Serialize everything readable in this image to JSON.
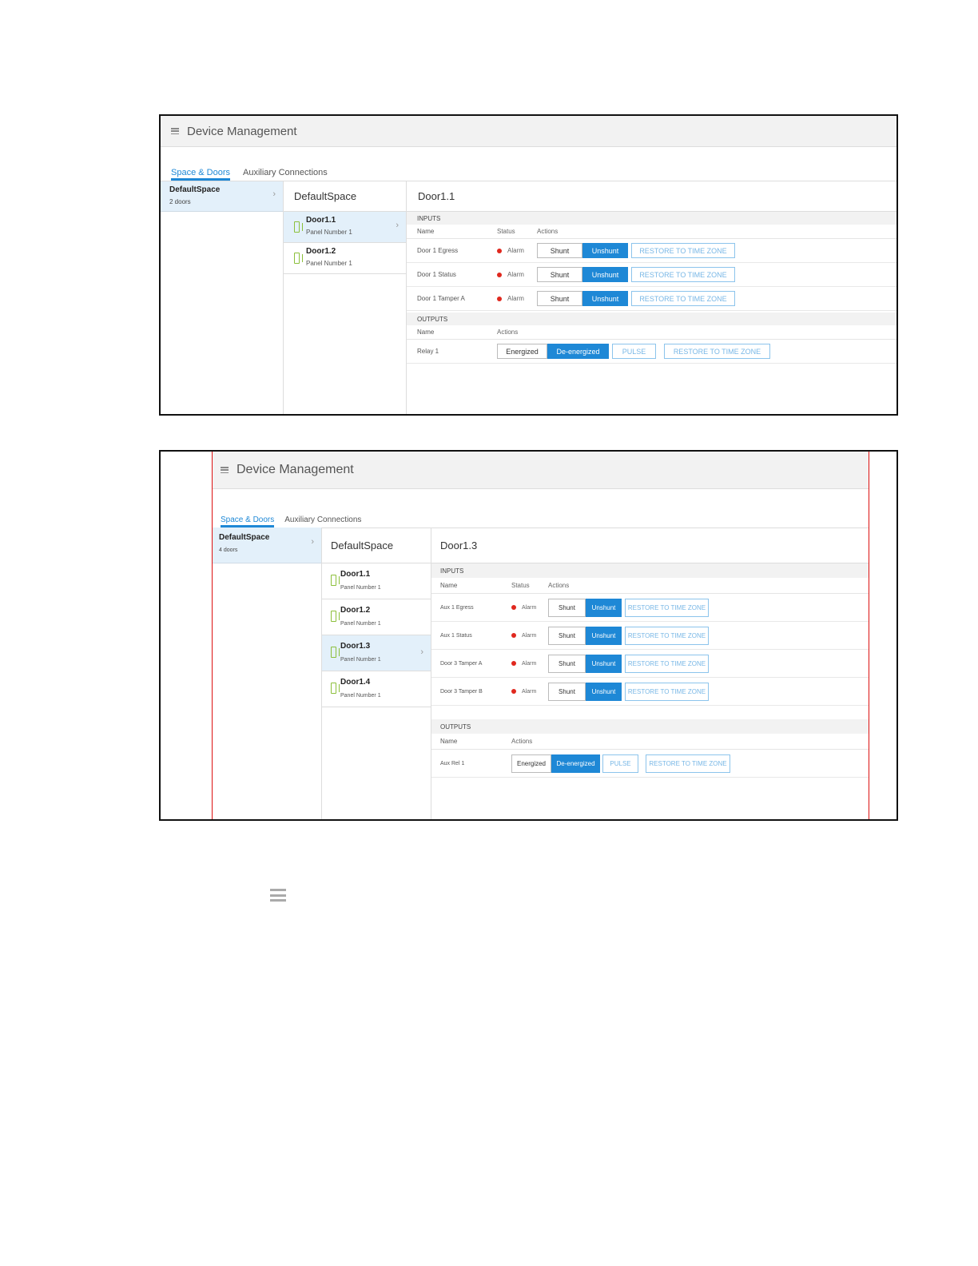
{
  "shot1": {
    "title": "Device Management",
    "tabs": [
      {
        "label": "Space & Doors"
      },
      {
        "label": "Auxiliary Connections"
      }
    ],
    "space": {
      "name": "DefaultSpace",
      "sub": "2 doors"
    },
    "col2_title": "DefaultSpace",
    "doors": [
      {
        "name": "Door1.1",
        "sub": "Panel Number 1"
      },
      {
        "name": "Door1.2",
        "sub": "Panel Number 1"
      }
    ],
    "detail_title": "Door1.1",
    "inputs_label": "INPUTS",
    "headers": {
      "name": "Name",
      "status": "Status",
      "actions": "Actions"
    },
    "inputs": [
      {
        "name": "Door 1 Egress",
        "status": "Alarm"
      },
      {
        "name": "Door 1 Status",
        "status": "Alarm"
      },
      {
        "name": "Door 1 Tamper A",
        "status": "Alarm"
      }
    ],
    "outputs_label": "OUTPUTS",
    "outputs": [
      {
        "name": "Relay 1"
      }
    ],
    "buttons": {
      "shunt": "Shunt",
      "unshunt": "Unshunt",
      "restore": "RESTORE TO TIME ZONE",
      "energized": "Energized",
      "deenergized": "De-energized",
      "pulse": "PULSE"
    }
  },
  "shot2": {
    "title": "Device Management",
    "tabs": [
      {
        "label": "Space & Doors"
      },
      {
        "label": "Auxiliary Connections"
      }
    ],
    "space": {
      "name": "DefaultSpace",
      "sub": "4 doors"
    },
    "col2_title": "DefaultSpace",
    "doors": [
      {
        "name": "Door1.1",
        "sub": "Panel Number 1"
      },
      {
        "name": "Door1.2",
        "sub": "Panel Number 1"
      },
      {
        "name": "Door1.3",
        "sub": "Panel Number 1"
      },
      {
        "name": "Door1.4",
        "sub": "Panel Number 1"
      }
    ],
    "detail_title": "Door1.3",
    "inputs_label": "INPUTS",
    "headers": {
      "name": "Name",
      "status": "Status",
      "actions": "Actions"
    },
    "inputs": [
      {
        "name": "Aux 1 Egress",
        "status": "Alarm"
      },
      {
        "name": "Aux 1 Status",
        "status": "Alarm"
      },
      {
        "name": "Door 3 Tamper A",
        "status": "Alarm"
      },
      {
        "name": "Door 3 Tamper B",
        "status": "Alarm"
      }
    ],
    "outputs_label": "OUTPUTS",
    "outputs": [
      {
        "name": "Aux Rel 1"
      }
    ],
    "buttons": {
      "shunt": "Shunt",
      "unshunt": "Unshunt",
      "restore": "RESTORE TO TIME ZONE",
      "energized": "Energized",
      "deenergized": "De-energized",
      "pulse": "PULSE"
    }
  },
  "colors": {
    "accent": "#1e88d6",
    "selected_bg": "#e3f0fa",
    "alarm": "#e0281e",
    "door_icon": "#8bbf3a",
    "frame_border": "#111111",
    "guide_line": "#dd1111"
  },
  "icons": {
    "menu": "hamburger-menu-icon",
    "chevron": "chevron-right-icon",
    "door": "door-icon",
    "alarm": "alarm-dot-icon"
  }
}
